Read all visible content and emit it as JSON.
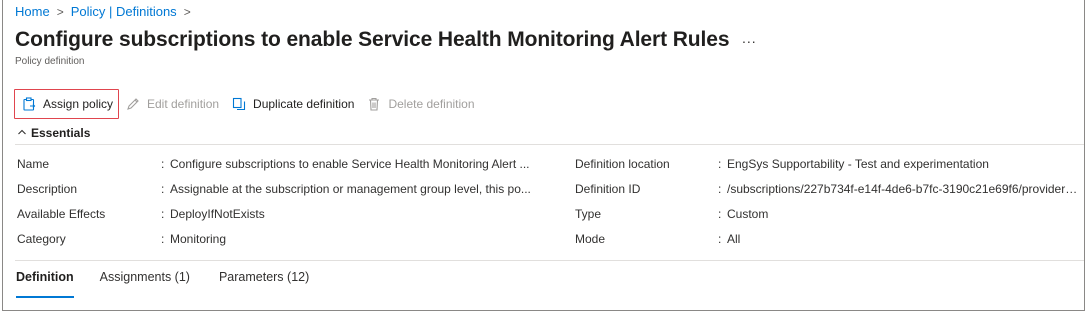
{
  "breadcrumb": {
    "home": "Home",
    "definitions": "Policy | Definitions",
    "separator": ">"
  },
  "header": {
    "title": "Configure subscriptions to enable Service Health Monitoring Alert Rules",
    "subtitle": "Policy definition",
    "more": "..."
  },
  "toolbar": {
    "assign": "Assign policy",
    "edit": "Edit definition",
    "duplicate": "Duplicate definition",
    "delete": "Delete definition"
  },
  "essentials": {
    "header": "Essentials",
    "colon": ":",
    "left": [
      {
        "label": "Name",
        "value": "Configure subscriptions to enable Service Health Monitoring Alert ..."
      },
      {
        "label": "Description",
        "value": "Assignable at the subscription or management group level, this po..."
      },
      {
        "label": "Available Effects",
        "value": "DeployIfNotExists"
      },
      {
        "label": "Category",
        "value": "Monitoring"
      }
    ],
    "right": [
      {
        "label": "Definition location",
        "value": "EngSys Supportability - Test and experimentation"
      },
      {
        "label": "Definition ID",
        "value": "/subscriptions/227b734f-e14f-4de6-b7fc-3190c21e69f6/providers/..."
      },
      {
        "label": "Type",
        "value": "Custom"
      },
      {
        "label": "Mode",
        "value": "All"
      }
    ]
  },
  "tabs": [
    {
      "label": "Definition",
      "active": true
    },
    {
      "label": "Assignments (1)",
      "active": false
    },
    {
      "label": "Parameters (12)",
      "active": false
    }
  ],
  "colors": {
    "accent": "#0078d4",
    "highlight_border": "#e0454e",
    "disabled_text": "#a19f9d"
  }
}
